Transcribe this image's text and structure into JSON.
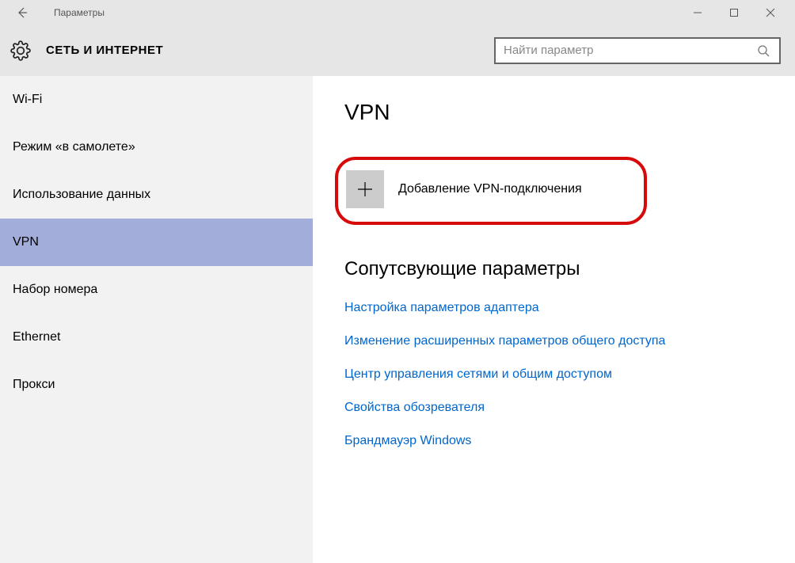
{
  "titlebar": {
    "title": "Параметры"
  },
  "header": {
    "section": "СЕТЬ И ИНТЕРНЕТ"
  },
  "search": {
    "placeholder": "Найти параметр"
  },
  "sidebar": {
    "items": [
      {
        "label": "Wi-Fi",
        "selected": false
      },
      {
        "label": "Режим «в самолете»",
        "selected": false
      },
      {
        "label": "Использование данных",
        "selected": false
      },
      {
        "label": "VPN",
        "selected": true
      },
      {
        "label": "Набор номера",
        "selected": false
      },
      {
        "label": "Ethernet",
        "selected": false
      },
      {
        "label": "Прокси",
        "selected": false
      }
    ]
  },
  "main": {
    "heading": "VPN",
    "add_vpn_label": "Добавление VPN-подключения",
    "related_heading": "Сопутсвующие параметры",
    "links": [
      "Настройка параметров адаптера",
      "Изменение расширенных параметров общего доступа",
      "Центр управления сетями и общим доступом",
      "Свойства обозревателя",
      "Брандмауэр Windows"
    ]
  }
}
